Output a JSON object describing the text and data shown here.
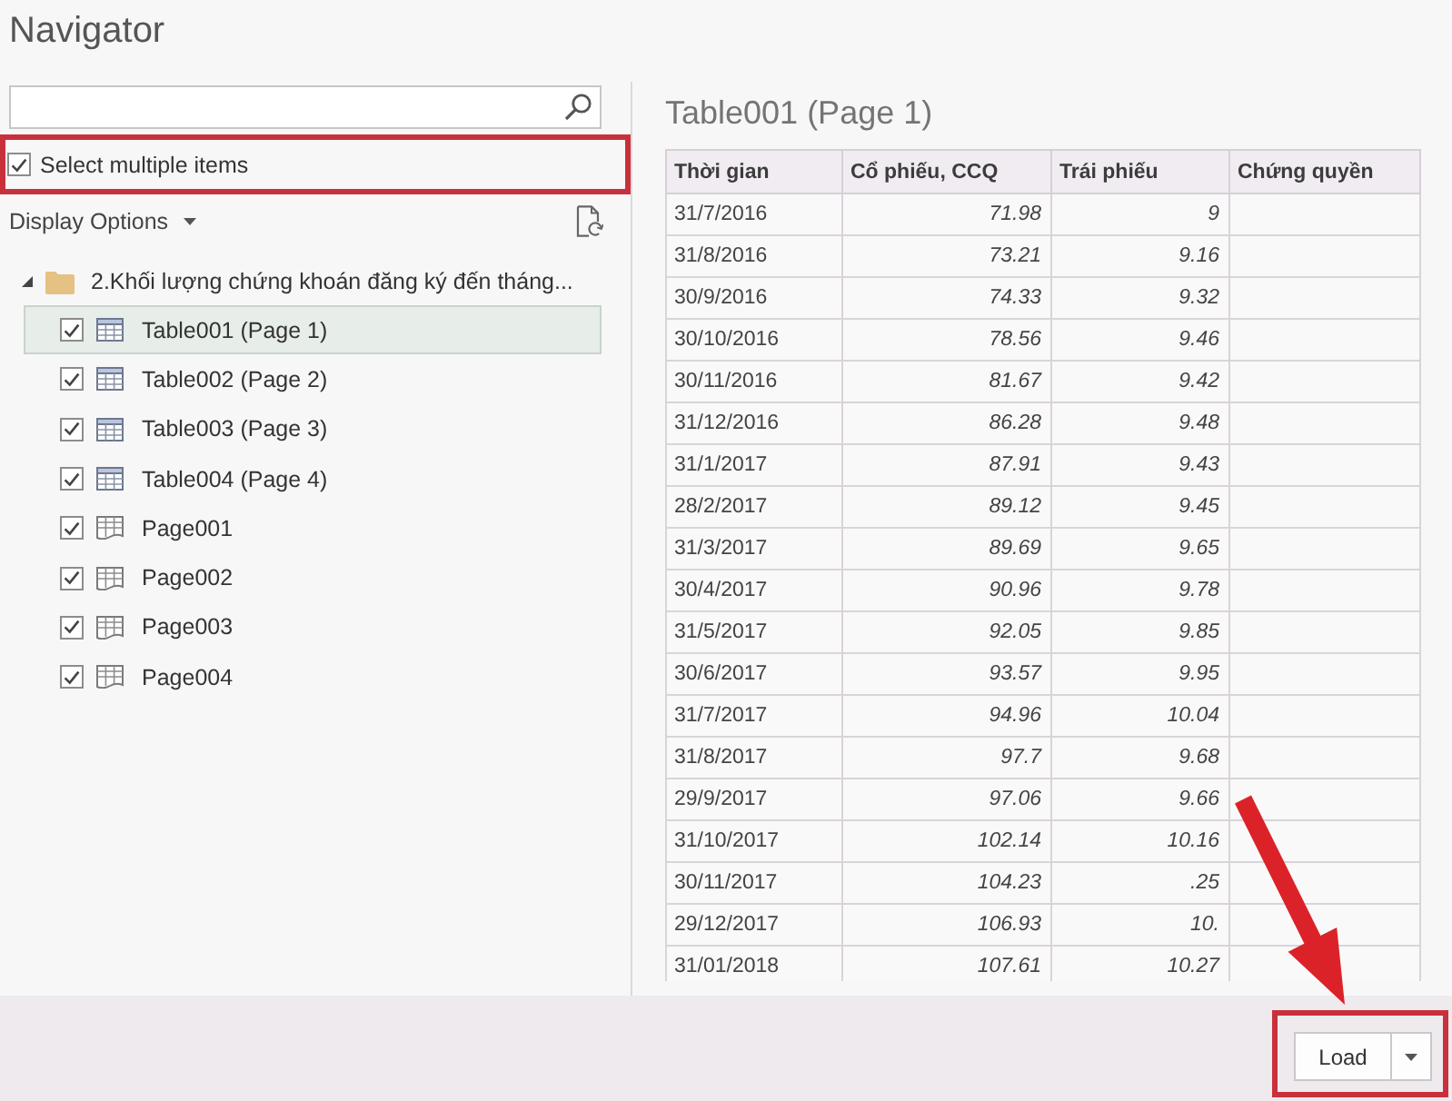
{
  "window": {
    "title": "Navigator"
  },
  "select_multiple": {
    "label": "Select multiple items",
    "checked": true,
    "highlighted": true
  },
  "display_options": {
    "label": "Display Options"
  },
  "tree": [
    {
      "label": "2.Khối lượng chứng khoán đăng ký đến tháng...",
      "kind": "folder",
      "expanded": true,
      "children": [
        {
          "label": "Table001 (Page 1)",
          "kind": "table",
          "checked": true,
          "selected": true
        },
        {
          "label": "Table002 (Page 2)",
          "kind": "table",
          "checked": true,
          "selected": false
        },
        {
          "label": "Table003 (Page 3)",
          "kind": "table",
          "checked": true,
          "selected": false
        },
        {
          "label": "Table004 (Page 4)",
          "kind": "table",
          "checked": true,
          "selected": false
        },
        {
          "label": "Page001",
          "kind": "page",
          "checked": true,
          "selected": false
        },
        {
          "label": "Page002",
          "kind": "page",
          "checked": true,
          "selected": false
        },
        {
          "label": "Page003",
          "kind": "page",
          "checked": true,
          "selected": false
        },
        {
          "label": "Page004",
          "kind": "page",
          "checked": true,
          "selected": false
        }
      ]
    }
  ],
  "preview": {
    "title": "Table001 (Page 1)",
    "table": {
      "columns": [
        {
          "label": "Thời gian",
          "kind": "text"
        },
        {
          "label": "Cổ phiếu, CCQ",
          "kind": "number"
        },
        {
          "label": "Trái phiếu",
          "kind": "number"
        },
        {
          "label": "Chứng quyền",
          "kind": "number"
        }
      ],
      "rows": [
        [
          "31/7/2016",
          "71.98",
          "9"
        ],
        [
          "31/8/2016",
          "73.21",
          "9.16"
        ],
        [
          "30/9/2016",
          "74.33",
          "9.32"
        ],
        [
          "30/10/2016",
          "78.56",
          "9.46"
        ],
        [
          "30/11/2016",
          "81.67",
          "9.42"
        ],
        [
          "31/12/2016",
          "86.28",
          "9.48"
        ],
        [
          "31/1/2017",
          "87.91",
          "9.43"
        ],
        [
          "28/2/2017",
          "89.12",
          "9.45"
        ],
        [
          "31/3/2017",
          "89.69",
          "9.65"
        ],
        [
          "30/4/2017",
          "90.96",
          "9.78"
        ],
        [
          "31/5/2017",
          "92.05",
          "9.85"
        ],
        [
          "30/6/2017",
          "93.57",
          "9.95"
        ],
        [
          "31/7/2017",
          "94.96",
          "10.04"
        ],
        [
          "31/8/2017",
          "97.7",
          "9.68"
        ],
        [
          "29/9/2017",
          "97.06",
          "9.66"
        ],
        [
          "31/10/2017",
          "102.14",
          "10.16"
        ],
        [
          "30/11/2017",
          "104.23",
          ".25"
        ],
        [
          "29/12/2017",
          "106.93",
          "10."
        ],
        [
          "31/01/2018",
          "107.61",
          "10.27"
        ]
      ]
    }
  },
  "footer": {
    "load_button": {
      "label": "Load",
      "highlighted": true
    }
  },
  "annotation_arrow": true
}
